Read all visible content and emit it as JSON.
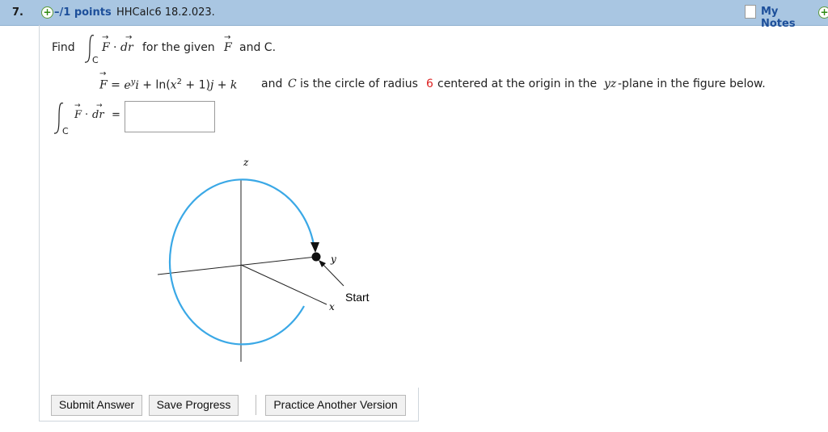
{
  "header": {
    "question_number": "7.",
    "points": "–/1 points",
    "code": "HHCalc6 18.2.023.",
    "my_notes": "My Notes"
  },
  "question": {
    "find": "Find",
    "for_the_given": "for the given",
    "and_c": "and C.",
    "f_def_pre": "and",
    "circle_text_1": "is the circle of radius",
    "radius": "6",
    "circle_text_2": "centered at the origin in the",
    "plane": "yz",
    "circle_text_3": "-plane in the figure below.",
    "integral_sub": "C",
    "F": "F",
    "dr": "dr",
    "C": "C"
  },
  "answer": {
    "equals": "=",
    "value": ""
  },
  "figure": {
    "z_label": "z",
    "y_label": "y",
    "x_label": "x",
    "start_label": "Start",
    "circle_color": "#3aa8e6"
  },
  "buttons": {
    "submit": "Submit Answer",
    "save": "Save Progress",
    "practice": "Practice Another Version"
  }
}
